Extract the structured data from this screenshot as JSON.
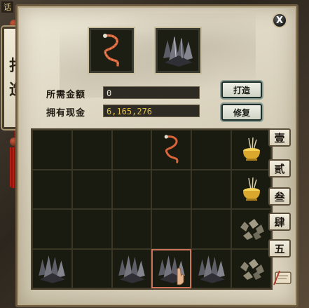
{
  "window": {
    "title_fragment": "话",
    "close_label": "X"
  },
  "side_tag": {
    "chars": [
      "打",
      "造"
    ]
  },
  "materials": [
    {
      "name": "rope-coil-icon"
    },
    {
      "name": "ore-cluster-icon"
    }
  ],
  "fields": {
    "required_label": "所需金额",
    "required_value": "0",
    "cash_label": "拥有现金",
    "cash_value": "6,165,276"
  },
  "buttons": {
    "forge": "打造",
    "repair": "修复"
  },
  "tabs": [
    "壹",
    "贰",
    "叁",
    "肆",
    "五"
  ],
  "inventory": [
    [
      "",
      "",
      "",
      "rope",
      "",
      "urn"
    ],
    [
      "",
      "",
      "",
      "",
      "",
      "urn"
    ],
    [
      "",
      "",
      "",
      "",
      "",
      "rocks"
    ],
    [
      "ore",
      "",
      "ore",
      "ore",
      "ore",
      "rocks"
    ]
  ],
  "colors": {
    "cash_text": "#e2c14a",
    "required_text": "#e8e2d0",
    "selected_border": "#c9735a"
  }
}
